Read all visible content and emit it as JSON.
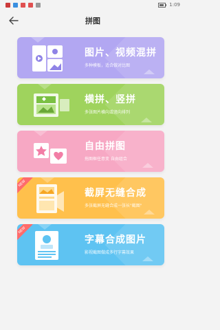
{
  "status": {
    "time": "1:09"
  },
  "header": {
    "title": "拼图"
  },
  "cards": [
    {
      "title": "图片、视频混拼",
      "subtitle": "多种模板，适合做对比图",
      "color": "#b2a7f2"
    },
    {
      "title": "横拼、竖拼",
      "subtitle": "多张图片横向或竖向排列",
      "color": "#9fd35d"
    },
    {
      "title": "自由拼图",
      "subtitle": "拖图框任意变 自由组合",
      "color": "#f7a8c4"
    },
    {
      "title": "截屏无缝合成",
      "subtitle": "多张截屏无缝合成一张长\"截图\"",
      "color": "#ffc04c",
      "badge": "NEW"
    },
    {
      "title": "字幕合成图片",
      "subtitle": "影视截图做成多行字幕效果",
      "color": "#5ec3f2",
      "badge": "NEW"
    }
  ]
}
